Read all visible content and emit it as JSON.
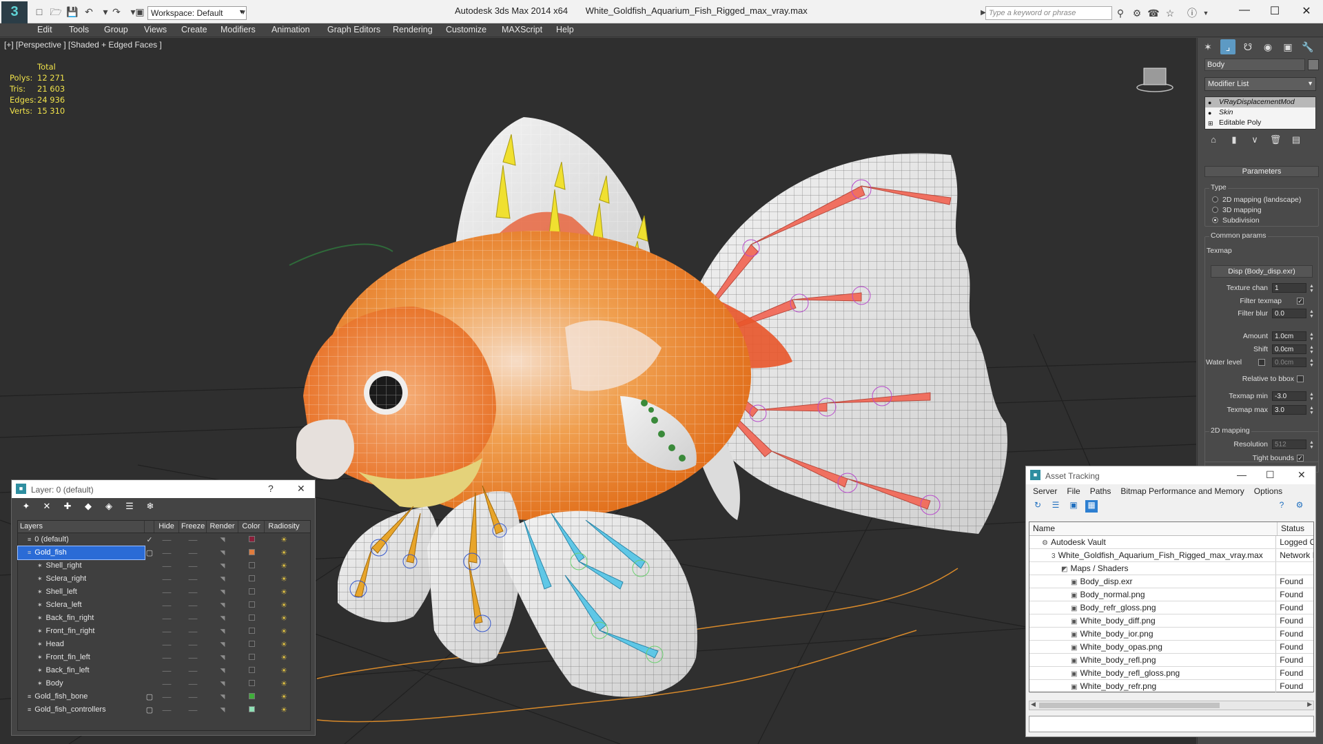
{
  "titlebar": {
    "app_name": "Autodesk 3ds Max  2014 x64",
    "file_name": "White_Goldfish_Aquarium_Fish_Rigged_max_vray.max",
    "app_logo": "3",
    "workspace": "Workspace: Default",
    "search_placeholder": "Type a keyword or phrase"
  },
  "menu": [
    "Edit",
    "Tools",
    "Group",
    "Views",
    "Create",
    "Modifiers",
    "Animation",
    "Graph Editors",
    "Rendering",
    "Customize",
    "MAXScript",
    "Help"
  ],
  "viewport": {
    "label": "[+] [Perspective ] [Shaded + Edged Faces ]",
    "stats_header": "Total",
    "stats": [
      {
        "key": "Polys:",
        "value": "12 271"
      },
      {
        "key": "Tris:",
        "value": "21 603"
      },
      {
        "key": "Edges:",
        "value": "24 936"
      },
      {
        "key": "Verts:",
        "value": "15 310"
      }
    ]
  },
  "command_panel": {
    "object_name": "Body",
    "modifier_list": "Modifier List",
    "stack": [
      "VRayDisplacementMod",
      "Skin",
      "Editable Poly"
    ],
    "rollout_title": "Parameters",
    "type_group": "Type",
    "type_options": [
      "2D mapping (landscape)",
      "3D mapping",
      "Subdivision"
    ],
    "type_selected": "Subdivision",
    "common_group": "Common params",
    "texmap_label": "Texmap",
    "texmap_button": "Disp (Body_disp.exr)",
    "texture_chan_label": "Texture chan",
    "texture_chan_value": "1",
    "filter_texmap_label": "Filter texmap",
    "filter_blur_label": "Filter blur",
    "filter_blur_value": "0.0",
    "amount_label": "Amount",
    "amount_value": "1.0cm",
    "shift_label": "Shift",
    "shift_value": "0.0cm",
    "water_level_label": "Water level",
    "water_level_value": "0.0cm",
    "relative_label": "Relative to bbox",
    "texmap_min_label": "Texmap min",
    "texmap_min_value": "-3.0",
    "texmap_max_label": "Texmap max",
    "texmap_max_value": "3.0",
    "mapping_group": "2D mapping",
    "resolution_label": "Resolution",
    "resolution_value": "512",
    "tight_label": "Tight bounds"
  },
  "layer_window": {
    "title": "Layer: 0 (default)",
    "help": "?",
    "columns": [
      "Layers",
      "Hide",
      "Freeze",
      "Render",
      "Color",
      "Radiosity"
    ],
    "rows": [
      {
        "name": "0 (default)",
        "indent": 0,
        "color": "#8a1f3a",
        "current": true,
        "selected": false
      },
      {
        "name": "Gold_fish",
        "indent": 0,
        "color": "#e07c3e",
        "current": false,
        "selected": true
      },
      {
        "name": "Shell_right",
        "indent": 1,
        "color": "#3b3b3b",
        "current": false,
        "selected": false
      },
      {
        "name": "Sclera_right",
        "indent": 1,
        "color": "#3b3b3b",
        "current": false,
        "selected": false
      },
      {
        "name": "Shell_left",
        "indent": 1,
        "color": "#3b3b3b",
        "current": false,
        "selected": false
      },
      {
        "name": "Sclera_left",
        "indent": 1,
        "color": "#3b3b3b",
        "current": false,
        "selected": false
      },
      {
        "name": "Back_fin_right",
        "indent": 1,
        "color": "#3b3b3b",
        "current": false,
        "selected": false
      },
      {
        "name": "Front_fin_right",
        "indent": 1,
        "color": "#3b3b3b",
        "current": false,
        "selected": false
      },
      {
        "name": "Head",
        "indent": 1,
        "color": "#3b3b3b",
        "current": false,
        "selected": false
      },
      {
        "name": "Front_fin_left",
        "indent": 1,
        "color": "#3b3b3b",
        "current": false,
        "selected": false
      },
      {
        "name": "Back_fin_left",
        "indent": 1,
        "color": "#3b3b3b",
        "current": false,
        "selected": false
      },
      {
        "name": "Body",
        "indent": 1,
        "color": "#3b3b3b",
        "current": false,
        "selected": false
      },
      {
        "name": "Gold_fish_bone",
        "indent": 0,
        "color": "#3fae3a",
        "current": false,
        "selected": false
      },
      {
        "name": "Gold_fish_controllers",
        "indent": 0,
        "color": "#8fe0b5",
        "current": false,
        "selected": false
      }
    ]
  },
  "asset_window": {
    "title": "Asset Tracking",
    "menu": [
      "Server",
      "File",
      "Paths",
      "Bitmap Performance and Memory",
      "Options"
    ],
    "columns": [
      "Name",
      "Status"
    ],
    "rows": [
      {
        "name": "Autodesk Vault",
        "status": "Logged O",
        "indent": 1,
        "icon": "vault"
      },
      {
        "name": "White_Goldfish_Aquarium_Fish_Rigged_max_vray.max",
        "status": "Network I",
        "indent": 2,
        "icon": "max-file"
      },
      {
        "name": "Maps / Shaders",
        "status": "",
        "indent": 3,
        "icon": "maps"
      },
      {
        "name": "Body_disp.exr",
        "status": "Found",
        "indent": 4,
        "icon": "image"
      },
      {
        "name": "Body_normal.png",
        "status": "Found",
        "indent": 4,
        "icon": "image"
      },
      {
        "name": "Body_refr_gloss.png",
        "status": "Found",
        "indent": 4,
        "icon": "image"
      },
      {
        "name": "White_body_diff.png",
        "status": "Found",
        "indent": 4,
        "icon": "image"
      },
      {
        "name": "White_body_ior.png",
        "status": "Found",
        "indent": 4,
        "icon": "image"
      },
      {
        "name": "White_body_opas.png",
        "status": "Found",
        "indent": 4,
        "icon": "image"
      },
      {
        "name": "White_body_refl.png",
        "status": "Found",
        "indent": 4,
        "icon": "image"
      },
      {
        "name": "White_body_refl_gloss.png",
        "status": "Found",
        "indent": 4,
        "icon": "image"
      },
      {
        "name": "White_body_refr.png",
        "status": "Found",
        "indent": 4,
        "icon": "image"
      }
    ]
  }
}
